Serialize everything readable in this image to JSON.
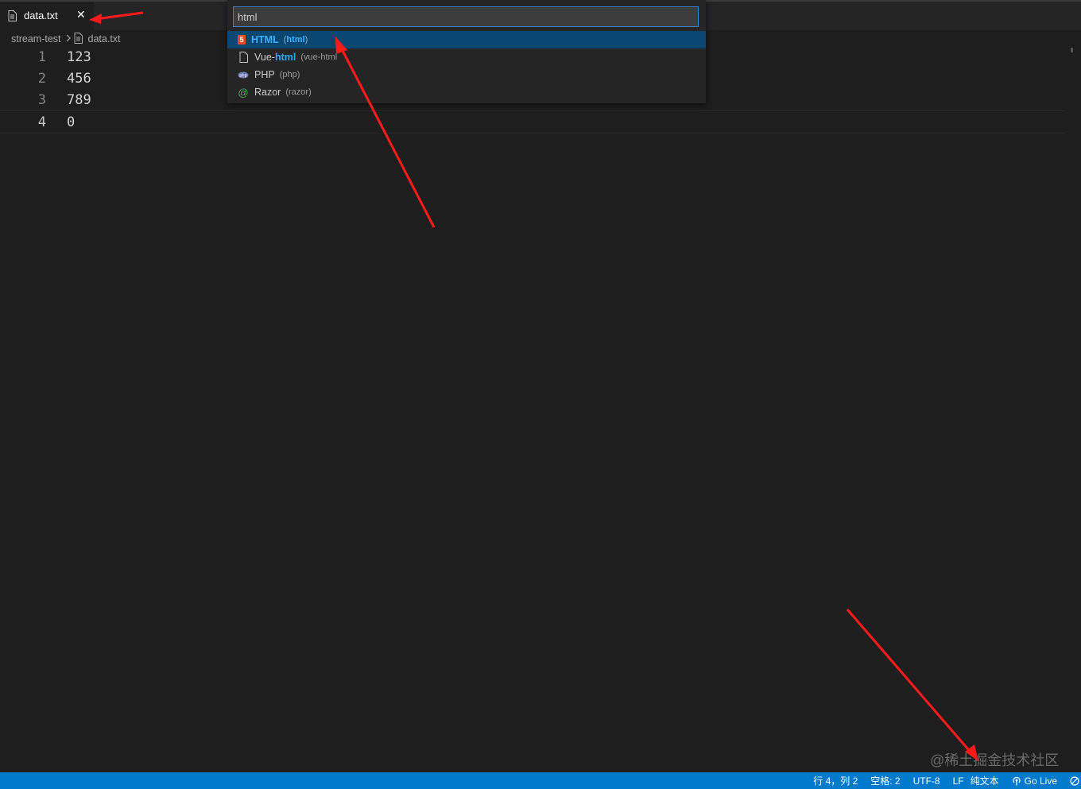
{
  "tab": {
    "label": "data.txt",
    "close": "✕"
  },
  "breadcrumb": {
    "folder": "stream-test",
    "file": "data.txt"
  },
  "editor": {
    "lines": [
      {
        "number": "1",
        "text": "123"
      },
      {
        "number": "2",
        "text": "456"
      },
      {
        "number": "3",
        "text": "789"
      },
      {
        "number": "4",
        "text": "0"
      }
    ]
  },
  "quickpick": {
    "query": "html",
    "items": [
      {
        "name": "HTML",
        "desc_open": "(",
        "desc_hl": "html",
        "desc_close": ")",
        "icon": "html5-icon"
      },
      {
        "name_pre": "Vue-",
        "name_hl": "html",
        "desc": "(vue-html",
        "icon": "file-icon"
      },
      {
        "name": "PHP",
        "desc": "(php)",
        "icon": "php-icon"
      },
      {
        "name": "Razor",
        "desc": "(razor)",
        "icon": "at-icon"
      }
    ]
  },
  "statusbar": {
    "position": "行 4，列 2",
    "indent": "空格: 2",
    "encoding": "UTF-8",
    "eol": "LF",
    "language": "纯文本",
    "golive": "Go Live"
  },
  "watermark": "@稀土掘金技术社区",
  "colors": {
    "statusbar": "#007acc",
    "selection": "#094771",
    "highlight": "#2aa7ff",
    "annotation": "#ff1a1a"
  }
}
